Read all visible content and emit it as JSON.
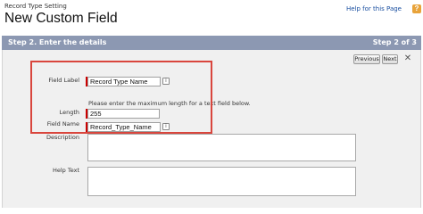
{
  "header": {
    "breadcrumb": "Record Type Setting",
    "title": "New Custom Field",
    "help_link": "Help for this Page",
    "help_icon": "?"
  },
  "step_bar": {
    "title": "Step 2. Enter the details",
    "counter": "Step 2 of 3"
  },
  "toolbar": {
    "previous_label": "Previous",
    "next_label": "Next",
    "close_symbol": "✕"
  },
  "form": {
    "field_label": {
      "label": "Field Label",
      "value": "Record Type Name"
    },
    "length_hint": "Please enter the maximum length for a text field below.",
    "length": {
      "label": "Length",
      "value": "255"
    },
    "field_name": {
      "label": "Field Name",
      "value": "Record_Type_Name"
    },
    "description": {
      "label": "Description"
    },
    "help_text": {
      "label": "Help Text"
    },
    "info_icon": "i"
  },
  "colors": {
    "step_bar": "#8c98b2",
    "required": "#cc0000",
    "highlight": "#d9463d",
    "link": "#1a4fa0"
  }
}
